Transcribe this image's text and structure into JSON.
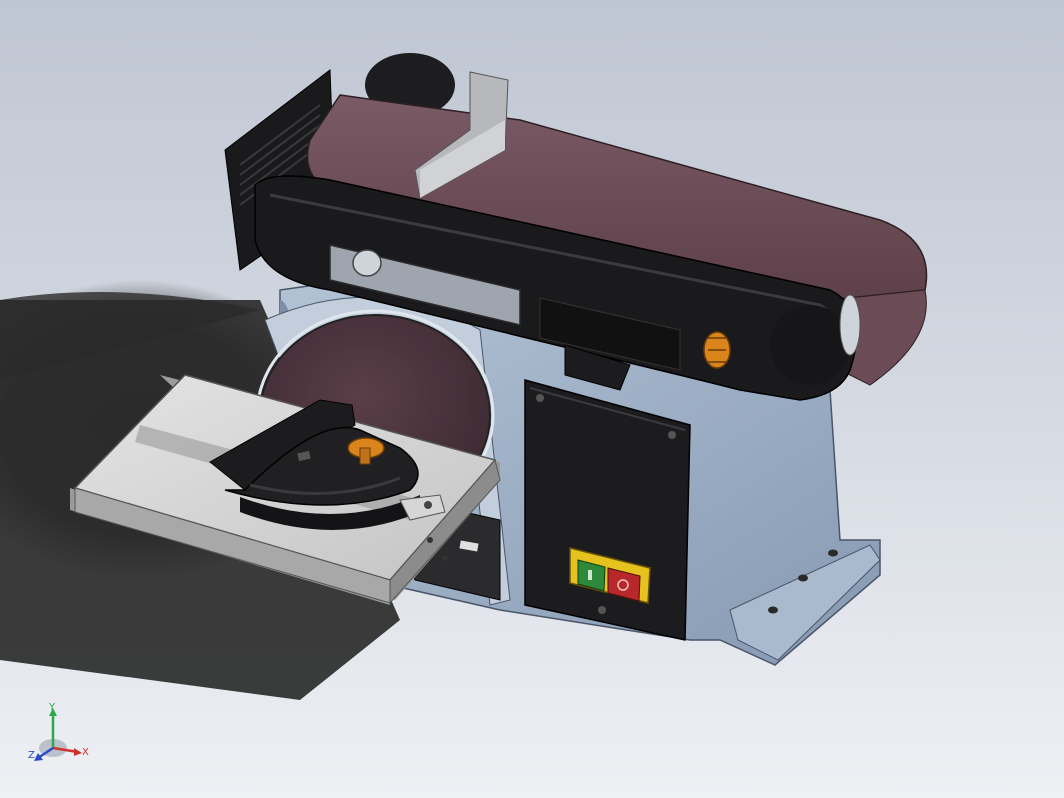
{
  "viewport": {
    "background_top": "#bfc6d3",
    "background_bottom": "#eef0f4"
  },
  "model": {
    "belt_color": "#6e4f59",
    "housing_color": "#1a1a1c",
    "base_color": "#9fb1c7",
    "table_color": "#d6d6d6",
    "knob_color": "#d9851c",
    "switch_frame_color": "#e6c21e",
    "start_button_color": "#2e8a3a",
    "stop_button_color": "#b8282a"
  },
  "triad": {
    "x_label": "X",
    "y_label": "Y",
    "z_label": "Z",
    "x_color": "#d0302e",
    "y_color": "#2aa84a",
    "z_color": "#2c49c8"
  }
}
